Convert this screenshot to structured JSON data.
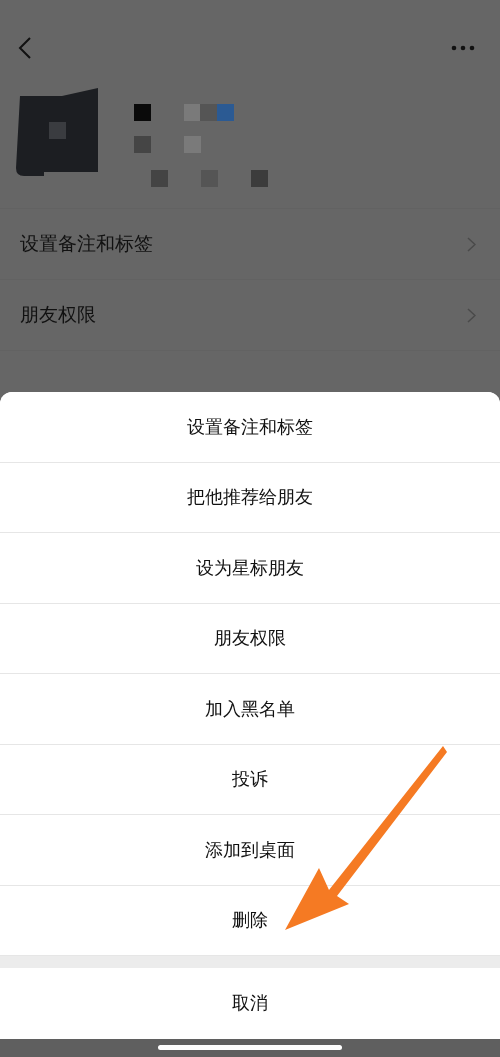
{
  "profile_menu": [
    {
      "label": "设置备注和标签"
    },
    {
      "label": "朋友权限"
    }
  ],
  "action_sheet": {
    "items": [
      {
        "label": "设置备注和标签"
      },
      {
        "label": "把他推荐给朋友"
      },
      {
        "label": "设为星标朋友"
      },
      {
        "label": "朋友权限"
      },
      {
        "label": "加入黑名单"
      },
      {
        "label": "投诉"
      },
      {
        "label": "添加到桌面"
      },
      {
        "label": "删除"
      }
    ],
    "cancel": "取消"
  }
}
